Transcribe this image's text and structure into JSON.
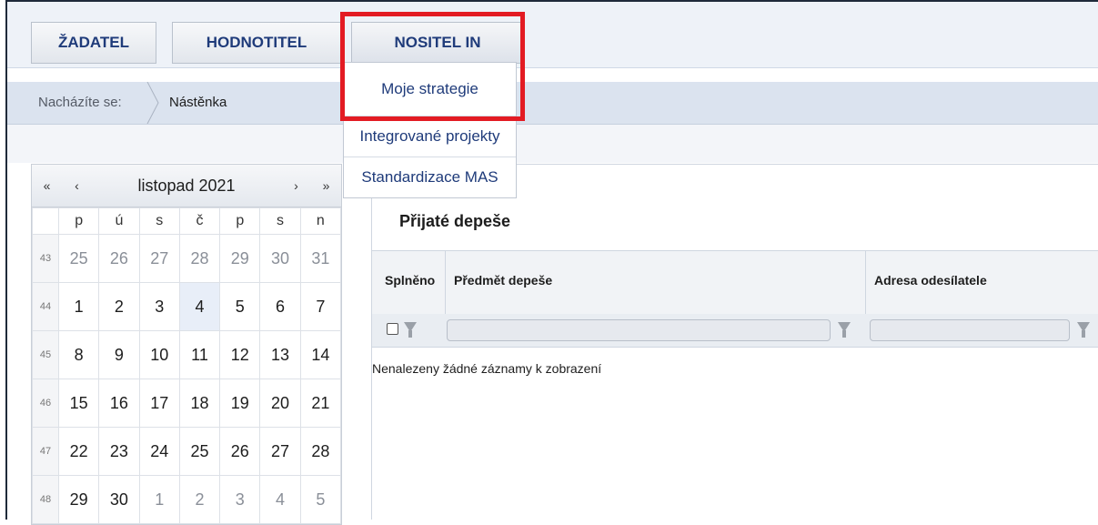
{
  "nav": {
    "zadatel": "ŽADATEL",
    "hodnotitel": "HODNOTITEL",
    "nositel": "NOSITEL IN"
  },
  "dropdown": {
    "items": [
      "Moje strategie",
      "Integrované projekty",
      "Standardizace MAS"
    ]
  },
  "breadcrumb": {
    "label": "Nacházíte se:",
    "current": "Nástěnka"
  },
  "calendar": {
    "title": "listopad 2021",
    "nav": {
      "first": "«",
      "prev": "‹",
      "next": "›",
      "last": "»"
    },
    "weekdays": [
      "p",
      "ú",
      "s",
      "č",
      "p",
      "s",
      "n"
    ],
    "weeks": [
      {
        "num": "43",
        "days": [
          "25",
          "26",
          "27",
          "28",
          "29",
          "30",
          "31"
        ],
        "other": [
          true,
          true,
          true,
          true,
          true,
          true,
          true
        ]
      },
      {
        "num": "44",
        "days": [
          "1",
          "2",
          "3",
          "4",
          "5",
          "6",
          "7"
        ],
        "other": [
          false,
          false,
          false,
          false,
          false,
          false,
          false
        ]
      },
      {
        "num": "45",
        "days": [
          "8",
          "9",
          "10",
          "11",
          "12",
          "13",
          "14"
        ],
        "other": [
          false,
          false,
          false,
          false,
          false,
          false,
          false
        ]
      },
      {
        "num": "46",
        "days": [
          "15",
          "16",
          "17",
          "18",
          "19",
          "20",
          "21"
        ],
        "other": [
          false,
          false,
          false,
          false,
          false,
          false,
          false
        ]
      },
      {
        "num": "47",
        "days": [
          "22",
          "23",
          "24",
          "25",
          "26",
          "27",
          "28"
        ],
        "other": [
          false,
          false,
          false,
          false,
          false,
          false,
          false
        ]
      },
      {
        "num": "48",
        "days": [
          "29",
          "30",
          "1",
          "2",
          "3",
          "4",
          "5"
        ],
        "other": [
          false,
          false,
          true,
          true,
          true,
          true,
          true
        ]
      }
    ],
    "today": "4"
  },
  "messages": {
    "title": "Přijaté depeše",
    "columns": [
      "Splněno",
      "Předmět depeše",
      "Adresa odesílatele"
    ],
    "empty": "Nenalezeny žádné záznamy k zobrazení"
  },
  "colors": {
    "highlight": "#e31b23",
    "nav_text": "#1f3b7a"
  }
}
